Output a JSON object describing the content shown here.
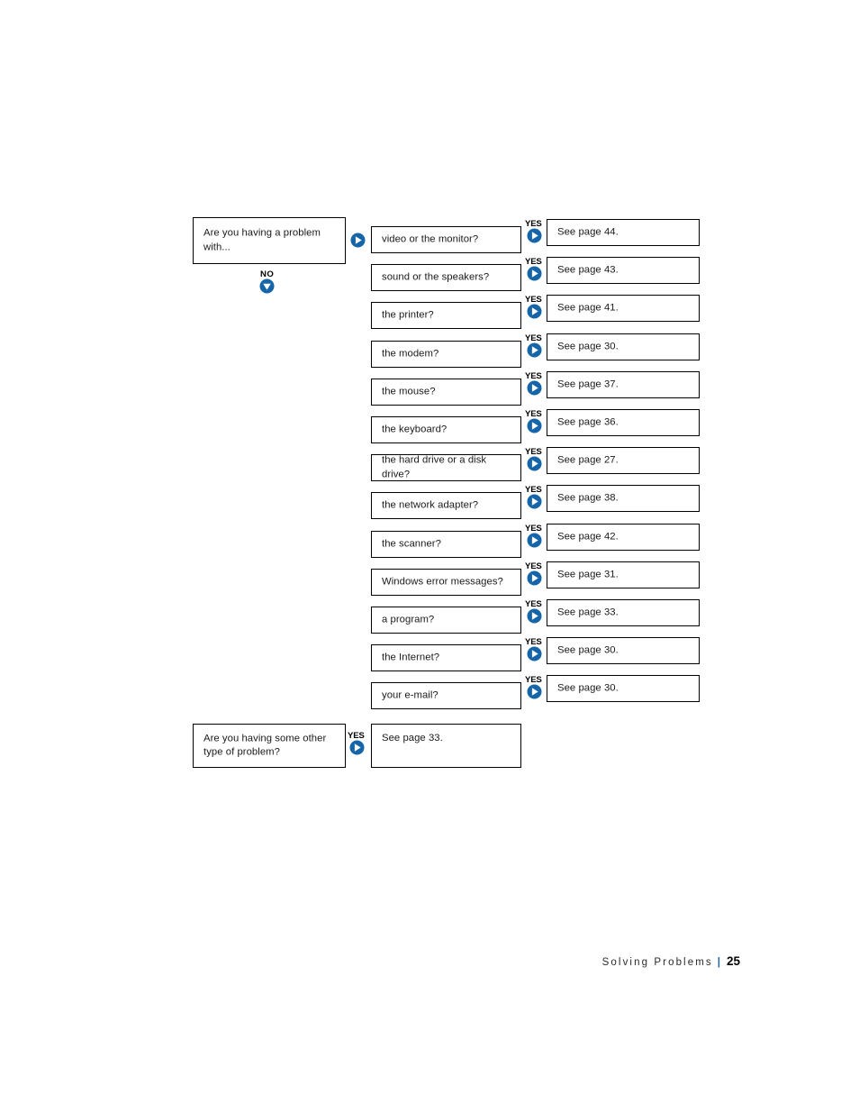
{
  "page": {
    "footer_chapter": "Solving Problems",
    "footer_separator": "|",
    "footer_page_number": "25"
  },
  "colors": {
    "accent_blue": "#1565a8",
    "box_border": "#000000",
    "text": "#1a1a1a",
    "background": "#ffffff"
  },
  "flowchart": {
    "start": {
      "label": "Are you having a problem\nwith...",
      "no_label": "NO",
      "no_icon": "circle-down-arrow-icon",
      "to_first_column_icon": "circle-right-arrow-icon"
    },
    "yes_label": "YES",
    "yes_icon": "circle-right-arrow-icon",
    "rows": [
      {
        "question": "video or the monitor?",
        "yes": "YES",
        "answer": "See page 44."
      },
      {
        "question": "sound or the speakers?",
        "yes": "YES",
        "answer": "See page 43."
      },
      {
        "question": "the printer?",
        "yes": "YES",
        "answer": "See page 41."
      },
      {
        "question": "the modem?",
        "yes": "YES",
        "answer": "See page 30."
      },
      {
        "question": "the mouse?",
        "yes": "YES",
        "answer": "See page 37."
      },
      {
        "question": "the keyboard?",
        "yes": "YES",
        "answer": "See page 36."
      },
      {
        "question": "the hard drive or a disk drive?",
        "yes": "YES",
        "answer": "See page 27."
      },
      {
        "question": "the network adapter?",
        "yes": "YES",
        "answer": "See page 38."
      },
      {
        "question": "the scanner?",
        "yes": "YES",
        "answer": "See page 42."
      },
      {
        "question": "Windows error messages?",
        "yes": "YES",
        "answer": "See page 31."
      },
      {
        "question": "a program?",
        "yes": "YES",
        "answer": "See page 33."
      },
      {
        "question": "the Internet?",
        "yes": "YES",
        "answer": "See page 30."
      },
      {
        "question": "your e-mail?",
        "yes": "YES",
        "answer": "See page 30."
      }
    ],
    "other": {
      "question": "Are you having some other\ntype of problem?",
      "yes": "YES",
      "answer": "See page 33."
    }
  }
}
